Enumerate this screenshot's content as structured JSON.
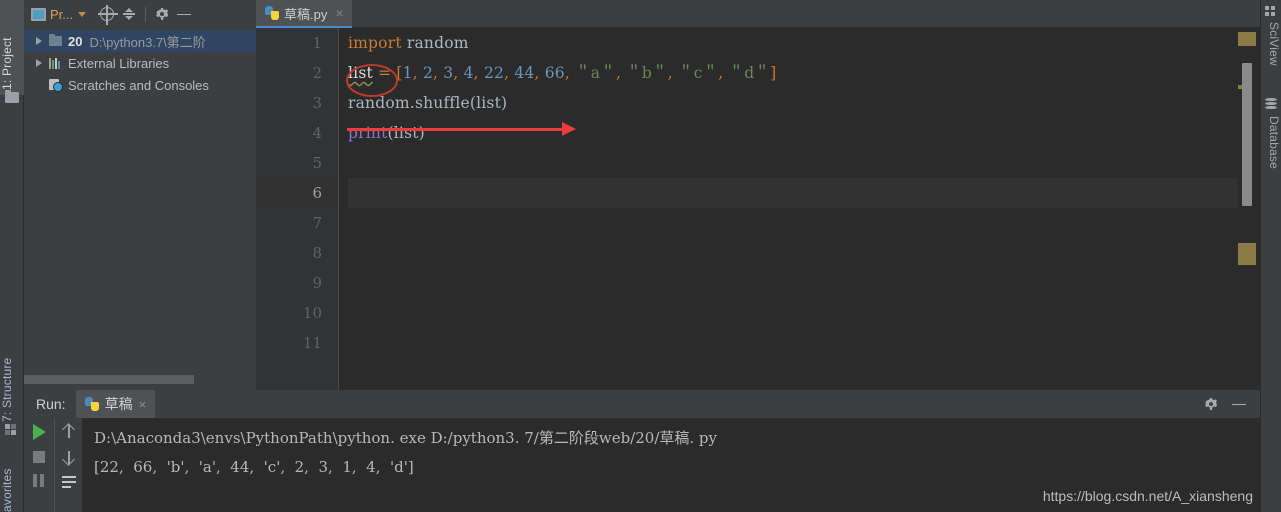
{
  "window": {
    "theme_bg": "#3c3f41",
    "editor_bg": "#2b2b2b",
    "accent": "#4a88c7"
  },
  "left_toolstrip": {
    "items": [
      {
        "label": "1: Project",
        "name": "sidebar-item-project",
        "active": true
      },
      {
        "label": "7: Structure",
        "name": "sidebar-item-structure",
        "active": false
      },
      {
        "label": "avorites",
        "name": "sidebar-item-favorites",
        "active": false
      }
    ]
  },
  "right_toolstrip": {
    "items": [
      {
        "label": "SciView",
        "name": "sidebar-item-sciview"
      },
      {
        "label": "Database",
        "name": "sidebar-item-database"
      }
    ]
  },
  "project_panel": {
    "toolbar": {
      "title": "Pr...",
      "icons": [
        "project-select-icon",
        "locate-target-icon",
        "collapse-all-icon",
        "gear-icon",
        "minimize-icon"
      ]
    },
    "tree": [
      {
        "label": "20",
        "path": "D:\\python3.7\\第二阶",
        "bold": true,
        "selected": true,
        "icon": "folder-icon",
        "expandable": true
      },
      {
        "label": "External Libraries",
        "path": "",
        "bold": false,
        "selected": false,
        "icon": "library-icon",
        "expandable": true
      },
      {
        "label": "Scratches and Consoles",
        "path": "",
        "bold": false,
        "selected": false,
        "icon": "scratches-icon",
        "expandable": false
      }
    ]
  },
  "editor": {
    "tab": {
      "label": "草稿.py",
      "icon": "python-file-icon",
      "close_label": "×"
    },
    "line_numbers": [
      "1",
      "2",
      "3",
      "4",
      "5",
      "6",
      "7",
      "8",
      "9",
      "10",
      "11"
    ],
    "current_line": 6,
    "lines": [
      {
        "n": 1,
        "tokens": [
          {
            "t": "import",
            "c": "kw"
          },
          {
            "t": " random",
            "c": "plain"
          }
        ]
      },
      {
        "n": 2,
        "tokens": [
          {
            "t": "list",
            "c": "ident-err"
          },
          {
            "t": " ",
            "c": "plain"
          },
          {
            "t": "=",
            "c": "punct"
          },
          {
            "t": " ",
            "c": "plain"
          },
          {
            "t": "[",
            "c": "punct"
          },
          {
            "t": "1",
            "c": "num"
          },
          {
            "t": ", ",
            "c": "punct"
          },
          {
            "t": "2",
            "c": "num"
          },
          {
            "t": ", ",
            "c": "punct"
          },
          {
            "t": "3",
            "c": "num"
          },
          {
            "t": ", ",
            "c": "punct"
          },
          {
            "t": "4",
            "c": "num"
          },
          {
            "t": ", ",
            "c": "punct"
          },
          {
            "t": "22",
            "c": "num"
          },
          {
            "t": ", ",
            "c": "punct"
          },
          {
            "t": "44",
            "c": "num"
          },
          {
            "t": ", ",
            "c": "punct"
          },
          {
            "t": "66",
            "c": "num"
          },
          {
            "t": ", ",
            "c": "punct"
          },
          {
            "t": "＂a＂",
            "c": "str"
          },
          {
            "t": ", ",
            "c": "punct"
          },
          {
            "t": "＂b＂",
            "c": "str"
          },
          {
            "t": ", ",
            "c": "punct"
          },
          {
            "t": "＂c＂",
            "c": "str"
          },
          {
            "t": ", ",
            "c": "punct"
          },
          {
            "t": "＂d＂",
            "c": "str"
          },
          {
            "t": "]",
            "c": "punct"
          }
        ]
      },
      {
        "n": 3,
        "tokens": [
          {
            "t": "random",
            "c": "plain"
          },
          {
            "t": ".",
            "c": "plain"
          },
          {
            "t": "shuffle",
            "c": "plain"
          },
          {
            "t": "(list)",
            "c": "plain"
          }
        ]
      },
      {
        "n": 4,
        "tokens": [
          {
            "t": "print",
            "c": "builtin"
          },
          {
            "t": "(list)",
            "c": "plain"
          }
        ]
      },
      {
        "n": 5,
        "tokens": []
      },
      {
        "n": 6,
        "tokens": []
      },
      {
        "n": 7,
        "tokens": []
      },
      {
        "n": 8,
        "tokens": []
      },
      {
        "n": 9,
        "tokens": []
      },
      {
        "n": 10,
        "tokens": []
      },
      {
        "n": 11,
        "tokens": []
      }
    ]
  },
  "annotations": {
    "ellipse_target": "list",
    "arrow_code": "points-right-from-line-3",
    "arrow_output": "points-right-under-output",
    "color": "#ef3b3b",
    "ellipse_color": "#c0392b"
  },
  "run_panel": {
    "label": "Run:",
    "tab": {
      "label": "草稿",
      "icon": "python-file-icon",
      "close_label": "×"
    },
    "toolbar_icons": [
      "run-icon",
      "stop-icon",
      "pause-icon",
      "scroll-up-icon",
      "scroll-down-icon",
      "soft-wrap-icon"
    ],
    "header_right_icons": [
      "gear-icon",
      "minimize-icon"
    ],
    "console": {
      "command_line": "D:\\Anaconda3\\envs\\PythonPath\\python. exe D:/python3. 7/第二阶段web/20/草稿. py",
      "output_line": "[22,  66,  'b',  'a',  44,  'c',  2,  3,  1,  4,  'd']"
    }
  },
  "watermark": {
    "text": "https://blog.csdn.net/A_xiansheng"
  }
}
